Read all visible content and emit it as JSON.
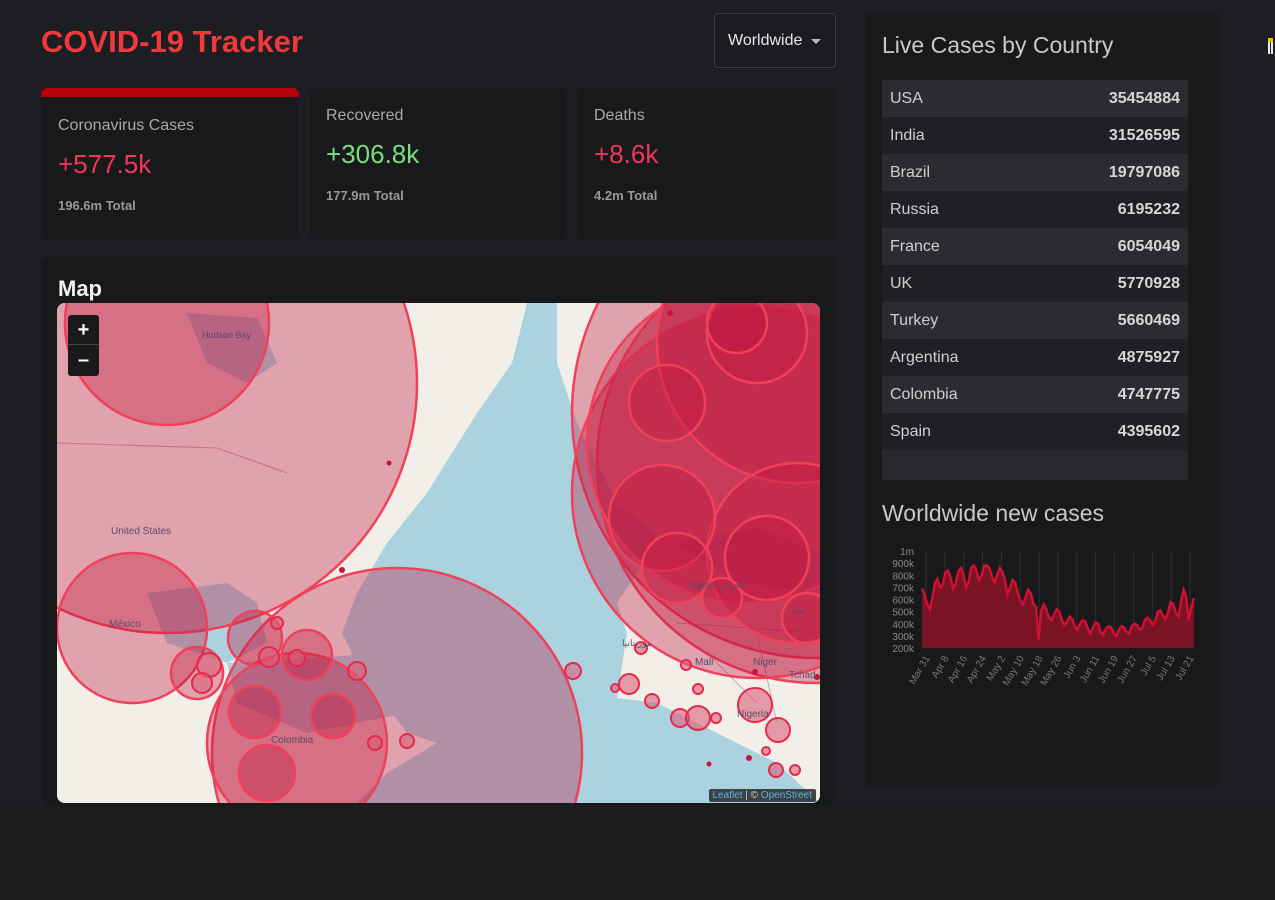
{
  "header": {
    "title": "COVID-19 Tracker",
    "country_select": "Worldwide"
  },
  "stats": [
    {
      "label": "Coronavirus Cases",
      "value": "+577.5k",
      "total": "196.6m Total",
      "color": "#f2365a",
      "active": true
    },
    {
      "label": "Recovered",
      "value": "+306.8k",
      "total": "177.9m Total",
      "color": "#7ddd7d",
      "active": false
    },
    {
      "label": "Deaths",
      "value": "+8.6k",
      "total": "4.2m Total",
      "color": "#f2365a",
      "active": false
    }
  ],
  "map": {
    "title": "Map",
    "zoom_in": "+",
    "zoom_out": "–",
    "labels": {
      "hudson_bay": "Hudson Bay",
      "united_states": "United States",
      "mexico": "México",
      "colombia": "Colombia",
      "mali": "Mali",
      "niger": "Niger",
      "nigeria": "Nigeria",
      "tchad": "Tchad",
      "algeria": "Algérie الجزائر",
      "mauritania": "موريتانيا",
      "libya": "ليبيا"
    },
    "attribution_leaflet": "Leaflet",
    "attribution_sep": " | © ",
    "attribution_osm": "OpenStreet"
  },
  "sidebar": {
    "live_title": "Live Cases by Country",
    "countries": [
      {
        "name": "USA",
        "cases": "35454884"
      },
      {
        "name": "India",
        "cases": "31526595"
      },
      {
        "name": "Brazil",
        "cases": "19797086"
      },
      {
        "name": "Russia",
        "cases": "6195232"
      },
      {
        "name": "France",
        "cases": "6054049"
      },
      {
        "name": "UK",
        "cases": "5770928"
      },
      {
        "name": "Turkey",
        "cases": "5660469"
      },
      {
        "name": "Argentina",
        "cases": "4875927"
      },
      {
        "name": "Colombia",
        "cases": "4747775"
      },
      {
        "name": "Spain",
        "cases": "4395602"
      }
    ],
    "chart_title": "Worldwide new cases"
  },
  "chart_data": {
    "type": "area",
    "title": "Worldwide new cases",
    "x_ticks": [
      "Mar 31",
      "Apr 8",
      "Apr 16",
      "Apr 24",
      "May 2",
      "May 10",
      "May 18",
      "May 26",
      "Jun 3",
      "Jun 11",
      "Jun 19",
      "Jun 27",
      "Jul 5",
      "Jul 13",
      "Jul 21"
    ],
    "y_ticks": [
      "1m",
      "900k",
      "800k",
      "700k",
      "600k",
      "500k",
      "400k",
      "300k",
      "200k"
    ],
    "ylim": [
      200000,
      1000000
    ],
    "color": "#d01030",
    "fill": "#7a1424",
    "series": [
      {
        "values": [
          690000,
          640000,
          560000,
          520000,
          610000,
          740000,
          770000,
          700000,
          720000,
          820000,
          840000,
          780000,
          690000,
          730000,
          830000,
          860000,
          810000,
          700000,
          740000,
          860000,
          880000,
          840000,
          760000,
          800000,
          880000,
          880000,
          860000,
          790000,
          740000,
          800000,
          860000,
          830000,
          760000,
          640000,
          700000,
          760000,
          740000,
          650000,
          590000,
          560000,
          620000,
          680000,
          650000,
          560000,
          540000,
          270000,
          510000,
          560000,
          520000,
          450000,
          430000,
          480000,
          520000,
          500000,
          430000,
          390000,
          420000,
          460000,
          440000,
          380000,
          350000,
          400000,
          430000,
          420000,
          360000,
          320000,
          370000,
          410000,
          400000,
          330000,
          310000,
          360000,
          380000,
          370000,
          320000,
          300000,
          350000,
          380000,
          370000,
          330000,
          320000,
          380000,
          400000,
          390000,
          350000,
          360000,
          430000,
          450000,
          430000,
          390000,
          420000,
          500000,
          510000,
          470000,
          440000,
          500000,
          580000,
          560000,
          490000,
          460000,
          580000,
          680000,
          620000,
          430000,
          540000,
          610000
        ]
      }
    ]
  }
}
